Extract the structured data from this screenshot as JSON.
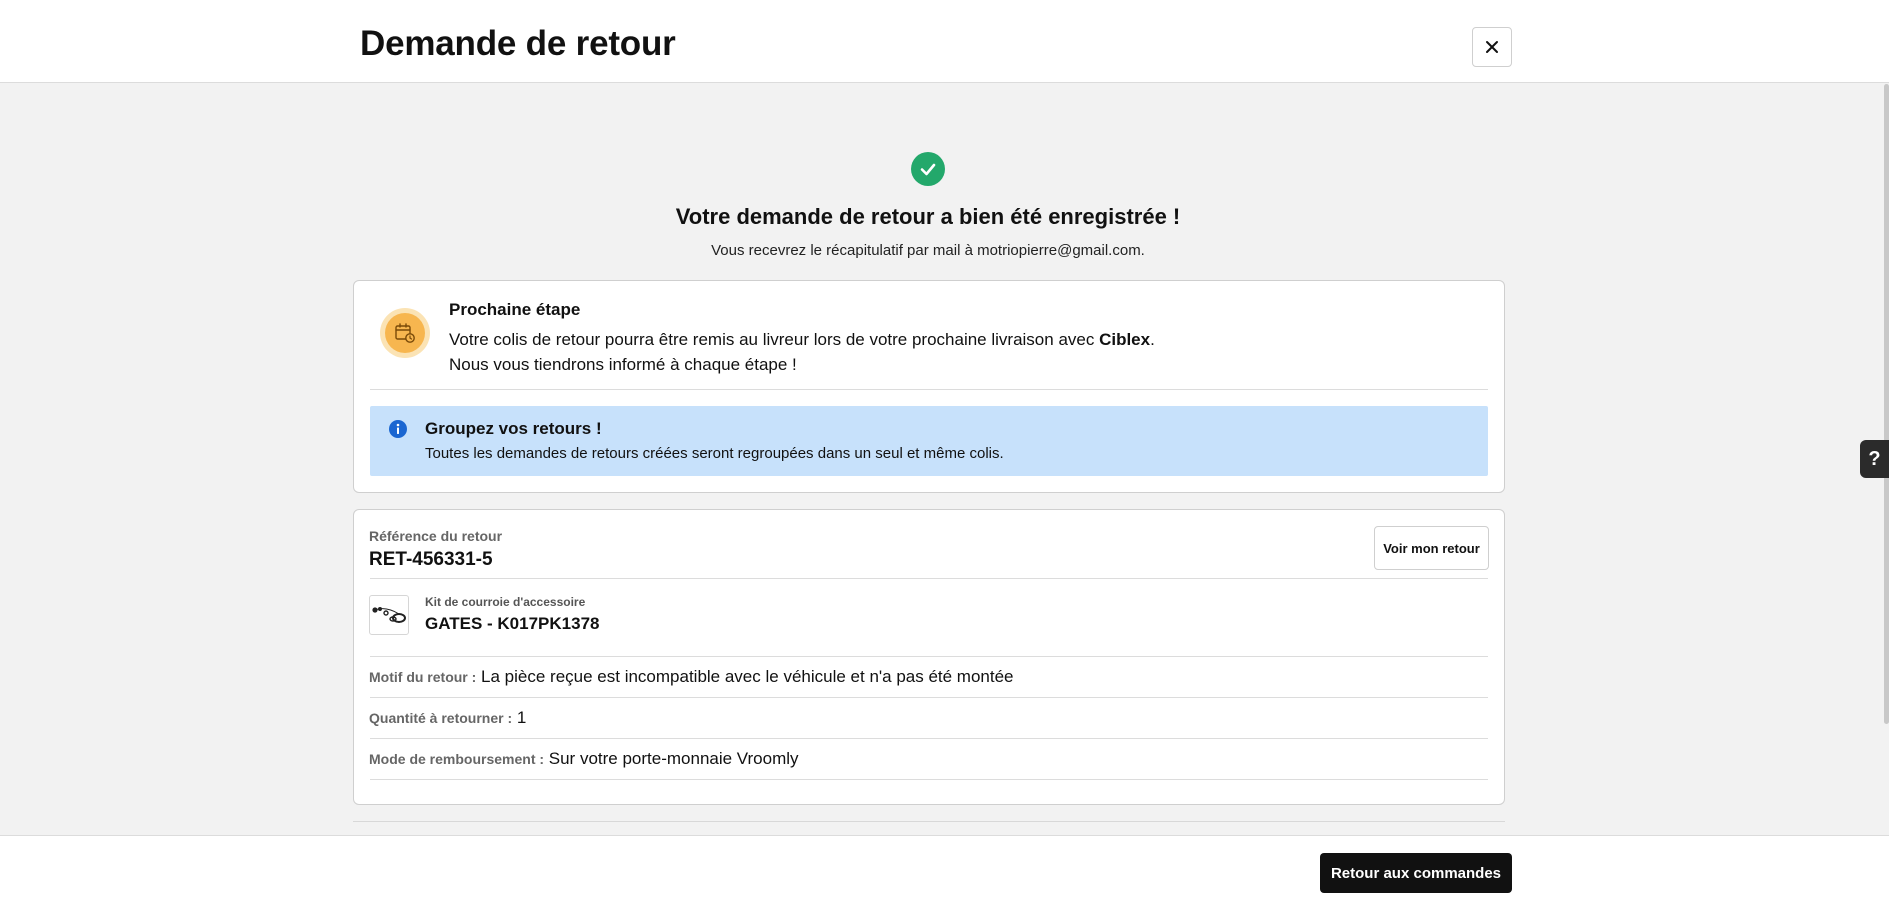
{
  "header": {
    "title": "Demande de retour",
    "close_icon": "close-icon"
  },
  "success": {
    "icon": "check-circle-icon",
    "title": "Votre demande de retour a bien été enregistrée !",
    "subtitle": "Vous recevrez le récapitulatif par mail à motriopierre@gmail.com."
  },
  "next_step": {
    "icon": "calendar-clock-icon",
    "title": "Prochaine étape",
    "text_before": "Votre colis de retour pourra être remis au livreur lors de votre prochaine livraison avec ",
    "carrier": "Ciblex",
    "text_after": ".",
    "line2": "Nous vous tiendrons informé à chaque étape !"
  },
  "info": {
    "icon": "info-icon",
    "title": "Groupez vos retours !",
    "text": "Toutes les demandes de retours créées seront regroupées dans un seul et même colis."
  },
  "return": {
    "ref_label": "Référence du retour",
    "ref_value": "RET-456331-5",
    "view_button": "Voir mon retour",
    "product": {
      "category": "Kit de courroie d'accessoire",
      "name": "GATES - K017PK1378"
    },
    "reason_label": "Motif du retour :",
    "reason_value": "La pièce reçue est incompatible avec le véhicule et n'a pas été montée",
    "qty_label": "Quantité à retourner :",
    "qty_value": "1",
    "refund_label": "Mode de remboursement :",
    "refund_value": "Sur votre porte-monnaie Vroomly"
  },
  "footer": {
    "back_button": "Retour aux commandes"
  },
  "help": {
    "label": "?"
  },
  "colors": {
    "success_green": "#23a86b",
    "info_bg": "#c7e1fb",
    "info_icon": "#1a66d1",
    "step_icon": "#f7b64f",
    "primary_button": "#111111"
  }
}
